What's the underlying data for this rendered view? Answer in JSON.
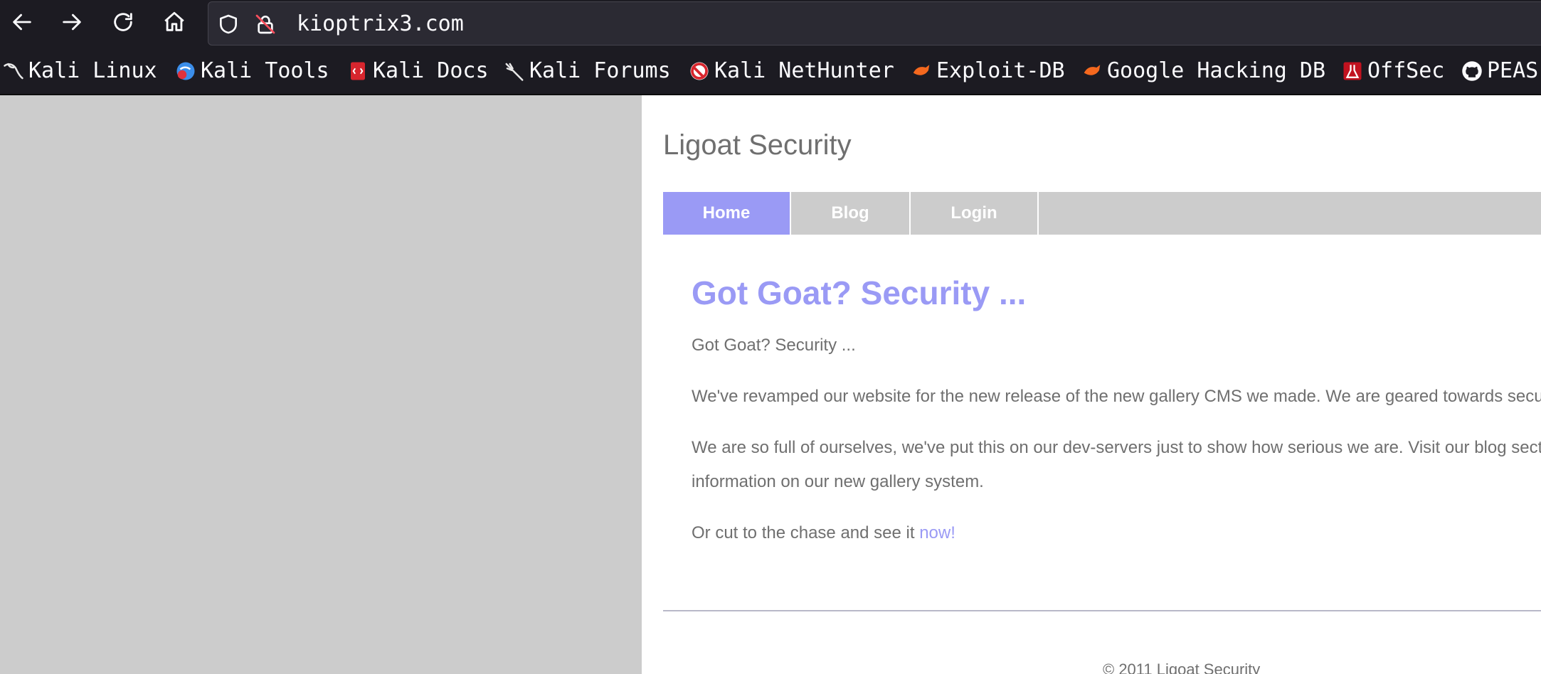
{
  "browser": {
    "nav": {
      "back_icon": "arrow-left-icon",
      "forward_icon": "arrow-right-icon",
      "reload_icon": "reload-icon",
      "home_icon": "home-icon"
    },
    "url": "kioptrix3.com",
    "bookmarks": [
      {
        "label": "Kali Linux",
        "icon": "kali-dragon-icon"
      },
      {
        "label": "Kali Tools",
        "icon": "kali-tools-icon"
      },
      {
        "label": "Kali Docs",
        "icon": "kali-docs-icon"
      },
      {
        "label": "Kali Forums",
        "icon": "kali-forums-icon"
      },
      {
        "label": "Kali NetHunter",
        "icon": "nethunter-icon"
      },
      {
        "label": "Exploit-DB",
        "icon": "exploit-db-icon"
      },
      {
        "label": "Google Hacking DB",
        "icon": "ghdb-icon"
      },
      {
        "label": "OffSec",
        "icon": "offsec-icon"
      },
      {
        "label": "PEAS",
        "icon": "github-icon"
      }
    ]
  },
  "site": {
    "title": "Ligoat Security",
    "menu": [
      {
        "label": "Home",
        "active": true
      },
      {
        "label": "Blog",
        "active": false
      },
      {
        "label": "Login",
        "active": false
      }
    ],
    "heading": "Got Goat? Security ...",
    "paragraphs": [
      "Got Goat? Security ...",
      "We've revamped our website for the new release of the new gallery CMS we made. We are geared towards secu",
      "We are so full of ourselves, we've put this on our dev-servers just to show how serious we are. Visit our blog sect",
      "information on our new gallery system."
    ],
    "cta_text": "Or cut to the chase and see it ",
    "cta_link": "now!",
    "footer": "© 2011 Ligoat Security"
  },
  "colors": {
    "accent": "#9a9af5",
    "text": "#6f6f6f",
    "menu_bg": "#cccccc",
    "chrome_bg": "#1c1b22"
  }
}
